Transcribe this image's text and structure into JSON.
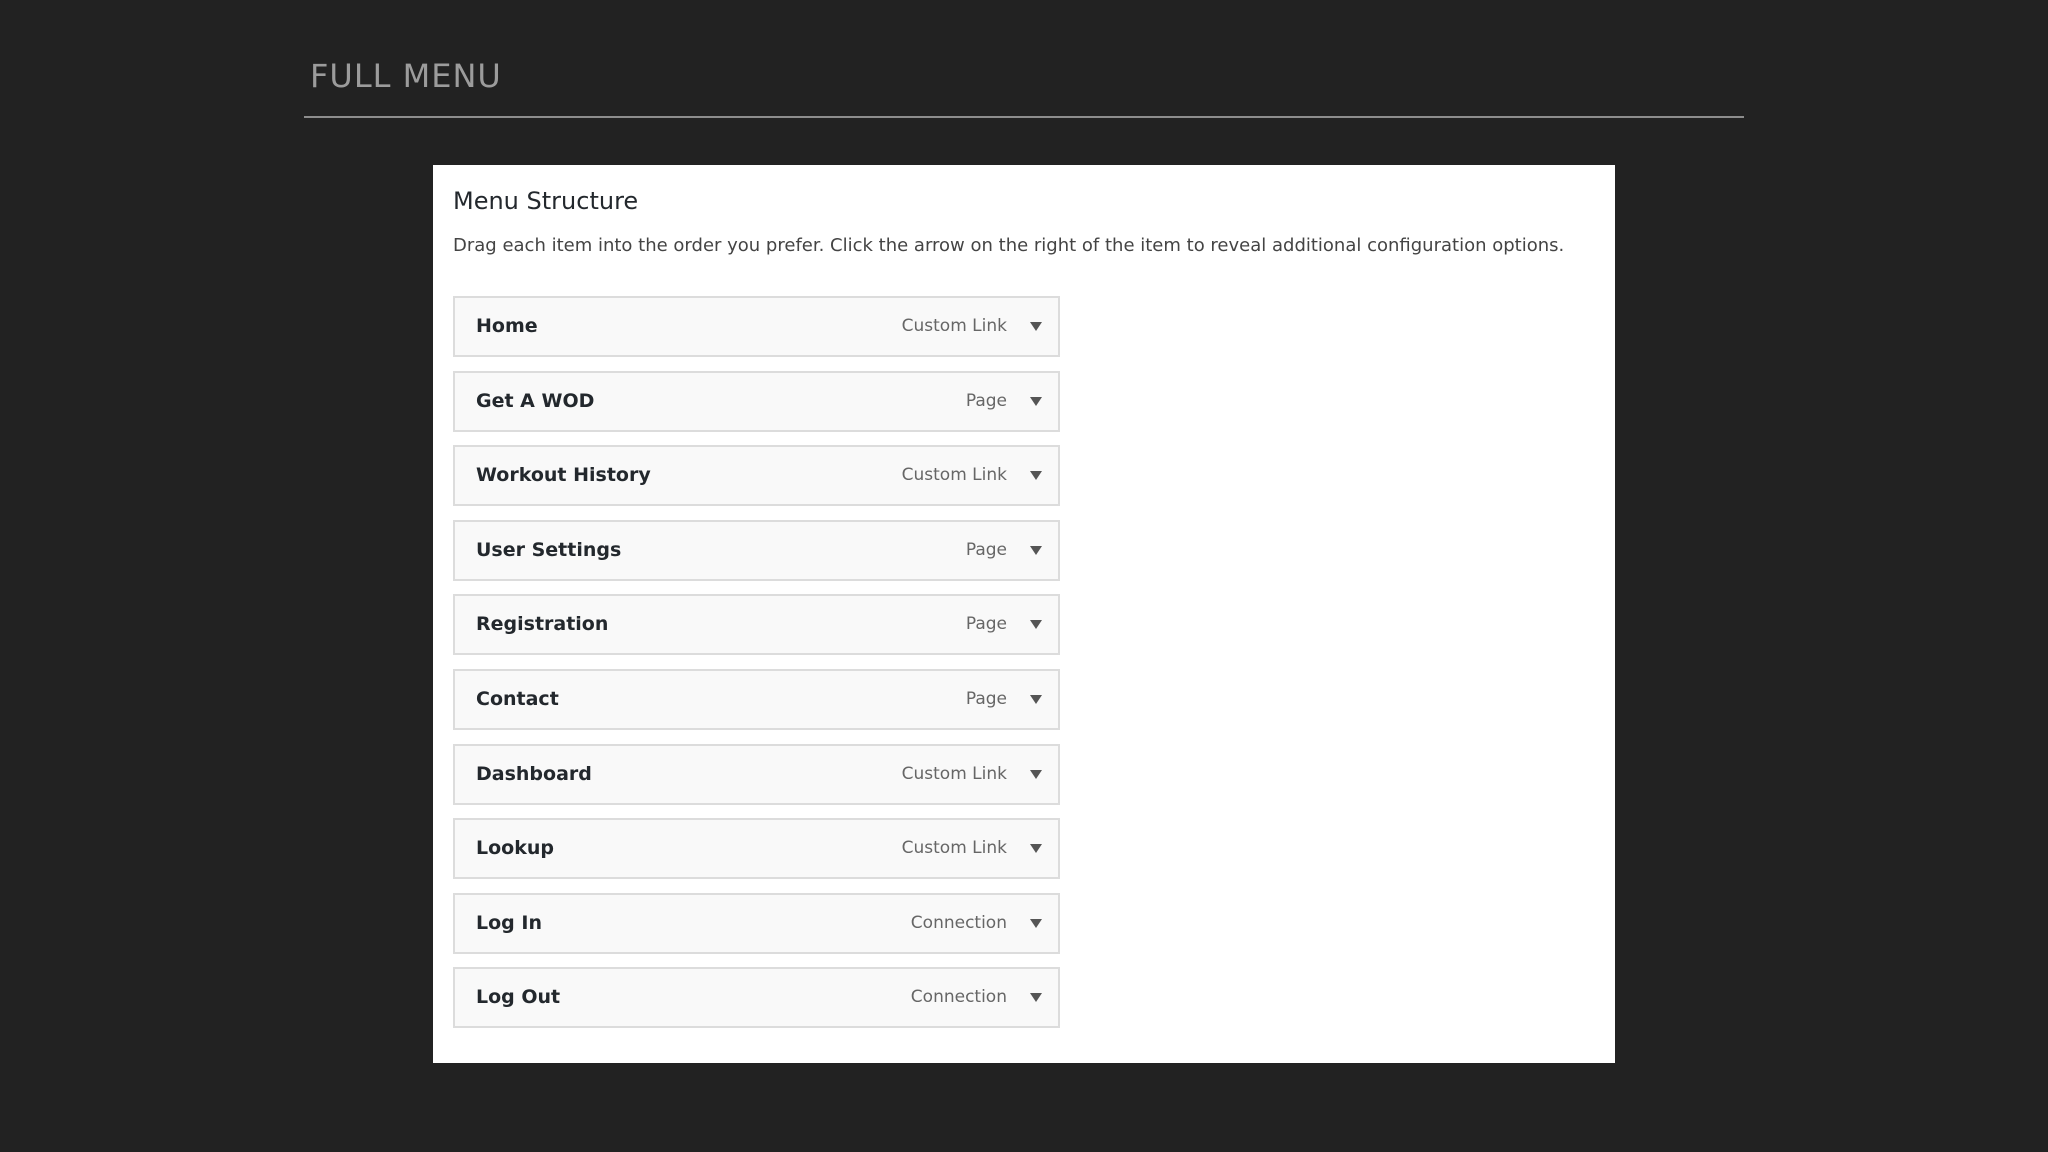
{
  "slide": {
    "title": "FULL MENU"
  },
  "panel": {
    "title": "Menu Structure",
    "description": "Drag each item into the order you prefer. Click the arrow on the right of the item to reveal additional configuration options.",
    "items": [
      {
        "title": "Home",
        "type": "Custom Link"
      },
      {
        "title": "Get A WOD",
        "type": "Page"
      },
      {
        "title": "Workout History",
        "type": "Custom Link"
      },
      {
        "title": "User Settings",
        "type": "Page"
      },
      {
        "title": "Registration",
        "type": "Page"
      },
      {
        "title": "Contact",
        "type": "Page"
      },
      {
        "title": "Dashboard",
        "type": "Custom Link"
      },
      {
        "title": "Lookup",
        "type": "Custom Link"
      },
      {
        "title": "Log In",
        "type": "Connection"
      },
      {
        "title": "Log Out",
        "type": "Connection"
      }
    ],
    "arrow_icon": "chevron-down-icon"
  },
  "colors": {
    "background": "#222222",
    "panel": "#ffffff",
    "item_background": "#f9f9f9",
    "item_border": "#dcdcdc",
    "slide_title": "#9c9c9c"
  }
}
